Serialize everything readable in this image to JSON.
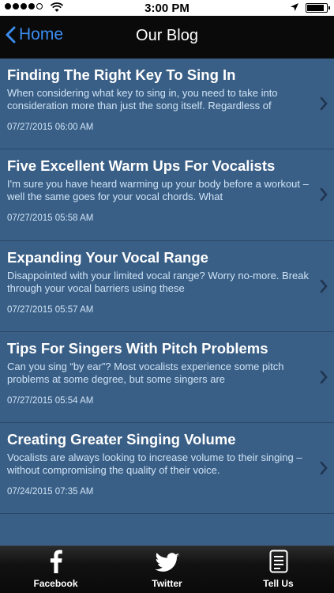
{
  "status": {
    "time": "3:00 PM",
    "signal_bars": 4,
    "battery_level": 0.9
  },
  "nav": {
    "back_label": "Home",
    "title": "Our Blog"
  },
  "posts": [
    {
      "title": "Finding The Right Key To Sing In",
      "excerpt": "When considering what key to sing in, you need to take into consideration more than just the song itself. Regardless of",
      "date": "07/27/2015 06:00 AM"
    },
    {
      "title": "Five Excellent Warm Ups For Vocalists",
      "excerpt": "I'm sure you have heard warming up your body before a workout – well the same goes for your vocal chords. What",
      "date": "07/27/2015 05:58 AM"
    },
    {
      "title": "Expanding Your Vocal Range",
      "excerpt": "Disappointed with your limited vocal range? Worry no-more. Break through your vocal barriers using these",
      "date": "07/27/2015 05:57 AM"
    },
    {
      "title": "Tips For Singers With Pitch Problems",
      "excerpt": "Can you sing “by ear”? Most vocalists experience some pitch problems at some degree, but some singers are",
      "date": "07/27/2015 05:54 AM"
    },
    {
      "title": "Creating Greater Singing Volume",
      "excerpt": "Vocalists are always looking to increase volume to their singing – without compromising the quality of their voice.",
      "date": "07/24/2015 07:35 AM"
    }
  ],
  "tabs": [
    {
      "label": "Facebook",
      "icon": "facebook-icon"
    },
    {
      "label": "Twitter",
      "icon": "twitter-icon"
    },
    {
      "label": "Tell Us",
      "icon": "document-icon"
    }
  ],
  "colors": {
    "background": "#3a5f86",
    "nav": "#0a0a0a",
    "accent": "#3b8df0",
    "excerpt": "#cfe3f6"
  }
}
